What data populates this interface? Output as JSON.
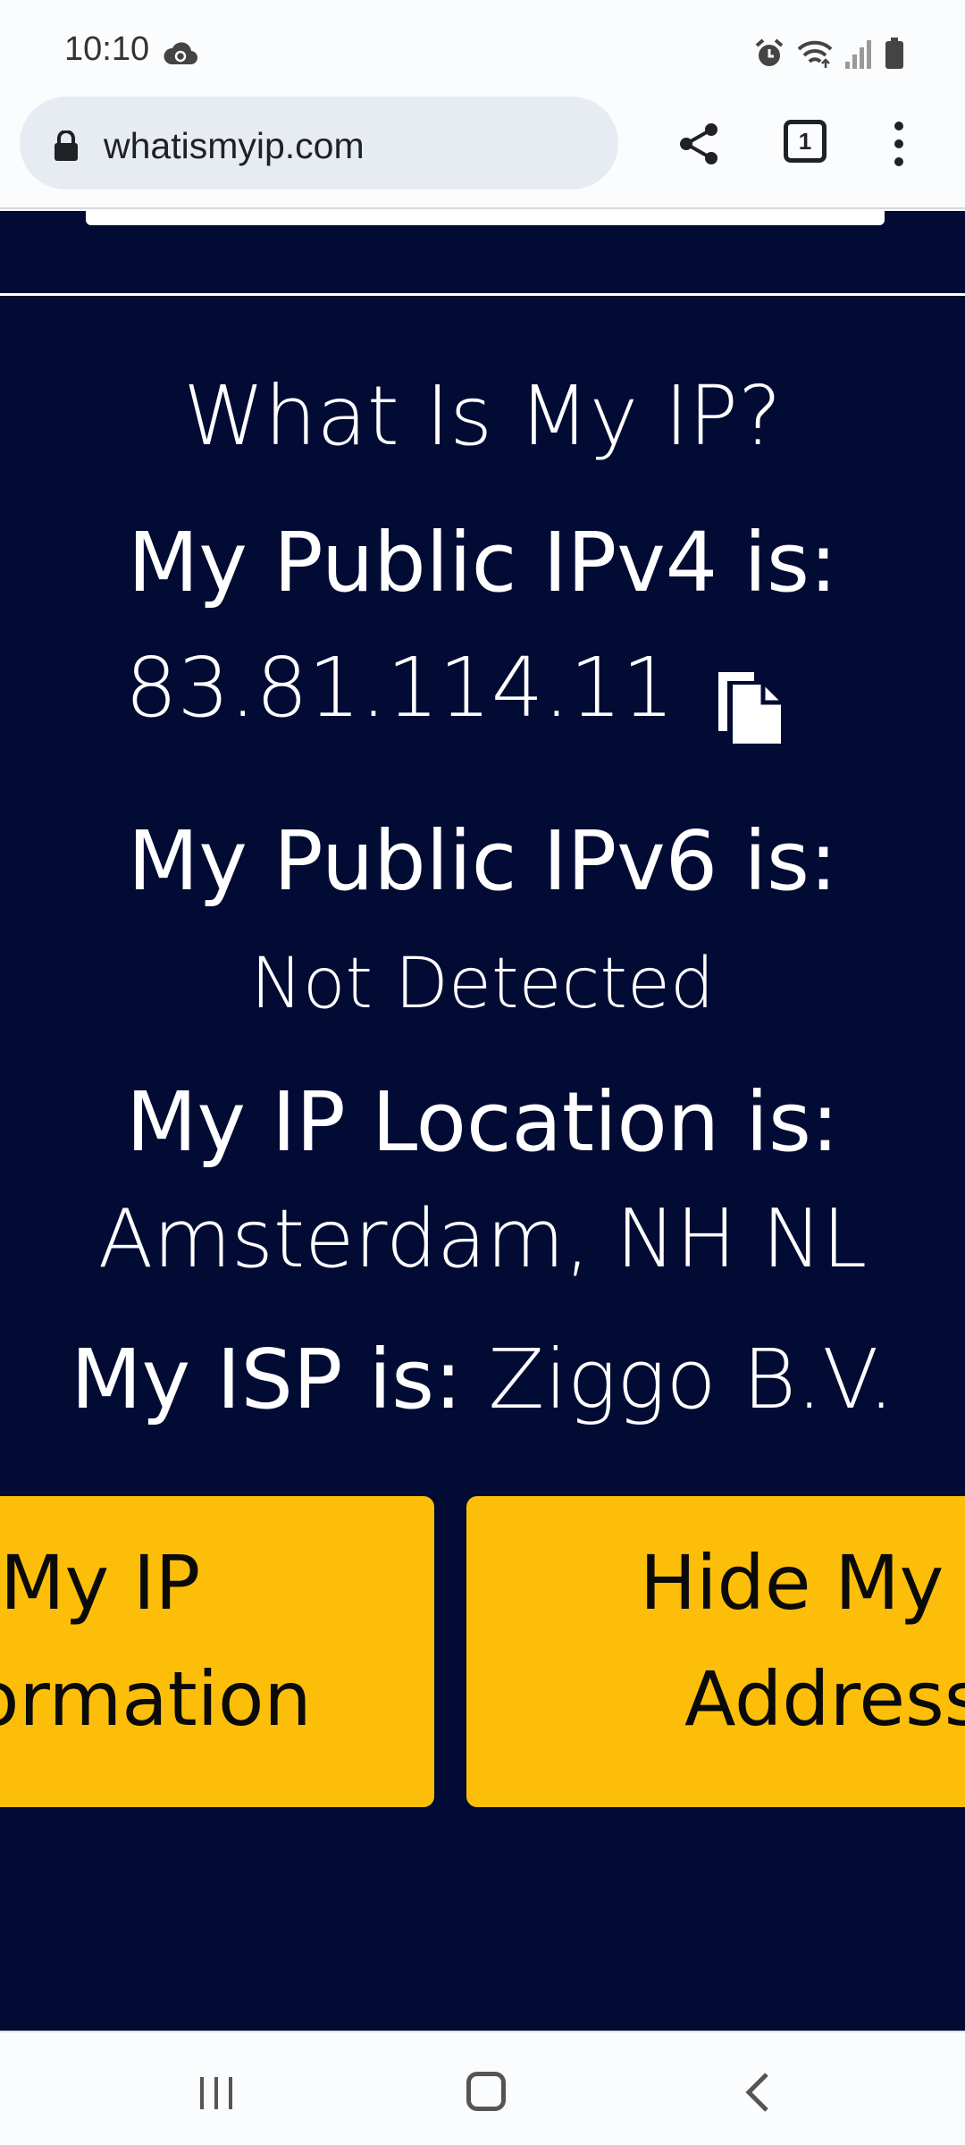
{
  "status_bar": {
    "time": "10:10",
    "icons": [
      "cloud-sync-icon",
      "alarm-icon",
      "wifi-icon",
      "signal-icon",
      "battery-icon"
    ]
  },
  "browser": {
    "url": "whatismyip.com",
    "tab_count": "1",
    "icons": [
      "lock-icon",
      "share-icon",
      "tabs-icon",
      "menu-icon"
    ]
  },
  "page": {
    "title": "What Is My IP?",
    "ipv4_heading": "My Public IPv4 is:",
    "ipv4_value": "83.81.114.11",
    "ipv6_heading": "My Public IPv6 is:",
    "ipv6_value": "Not Detected",
    "location_heading": "My IP Location is:",
    "location_value": "Amsterdam, NH NL",
    "isp_label": "My ISP is:",
    "isp_value": "Ziggo B.V.",
    "buttons": {
      "left": {
        "line1": "My IP",
        "line2": "ormation"
      },
      "right": {
        "line1": "Hide My I",
        "line2": "Address"
      }
    },
    "colors": {
      "background": "#020b34",
      "button": "#fdbe0a",
      "text": "#ffffff"
    }
  },
  "nav_bar": {
    "icons": [
      "recents-icon",
      "home-icon",
      "back-icon"
    ]
  }
}
